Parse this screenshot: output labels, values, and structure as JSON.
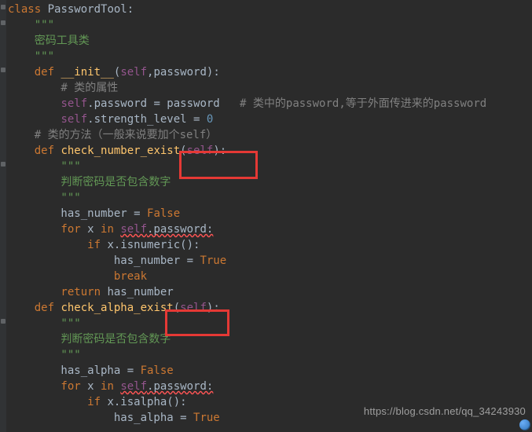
{
  "code": {
    "l0a": "class",
    "l0b": " PasswordTool:",
    "l1": "    \"\"\"",
    "l2": "    密码工具类",
    "l3": "    \"\"\"",
    "l4a": "    def ",
    "l4b": "__init__",
    "l4c": "(",
    "l4d": "self",
    "l4e": ",password):",
    "l5": "        # 类的属性",
    "l6a": "        ",
    "l6b": "self",
    "l6c": ".password = password   ",
    "l6d": "# 类中的password,等于外面传进来的password",
    "l7a": "        ",
    "l7b": "self",
    "l7c": ".strength_level = ",
    "l7d": "0",
    "l8": "",
    "l9": "    # 类的方法（一般来说要加个self）",
    "l10a": "    def ",
    "l10b": "check_number_exist",
    "l10c": "(",
    "l10d": "self",
    "l10e": "):",
    "l11": "        \"\"\"",
    "l12": "        判断密码是否包含数字",
    "l13": "        \"\"\"",
    "l14a": "        has_number = ",
    "l14b": "False",
    "l15a": "        for ",
    "l15b": "x ",
    "l15c": "in ",
    "l15d": "self",
    "l15e": ".password:",
    "l16a": "            if ",
    "l16b": "x.isnumeric():",
    "l17a": "                has_number = ",
    "l17b": "True",
    "l18": "                break",
    "l19a": "        return ",
    "l19b": "has_number",
    "l20": "",
    "l21a": "    def ",
    "l21b": "check_alpha_exist",
    "l21c": "(",
    "l21d": "self",
    "l21e": "):",
    "l22": "        \"\"\"",
    "l23": "        判断密码是否包含数字",
    "l24": "        \"\"\"",
    "l25a": "        has_alpha = ",
    "l25b": "False",
    "l26a": "        for ",
    "l26b": "x ",
    "l26c": "in ",
    "l26d": "self",
    "l26e": ".password:",
    "l27a": "            if ",
    "l27b": "x.isalpha():",
    "l28a": "                has_alpha = ",
    "l28b": "True"
  },
  "watermark": "https://blog.csdn.net/qq_34243930"
}
